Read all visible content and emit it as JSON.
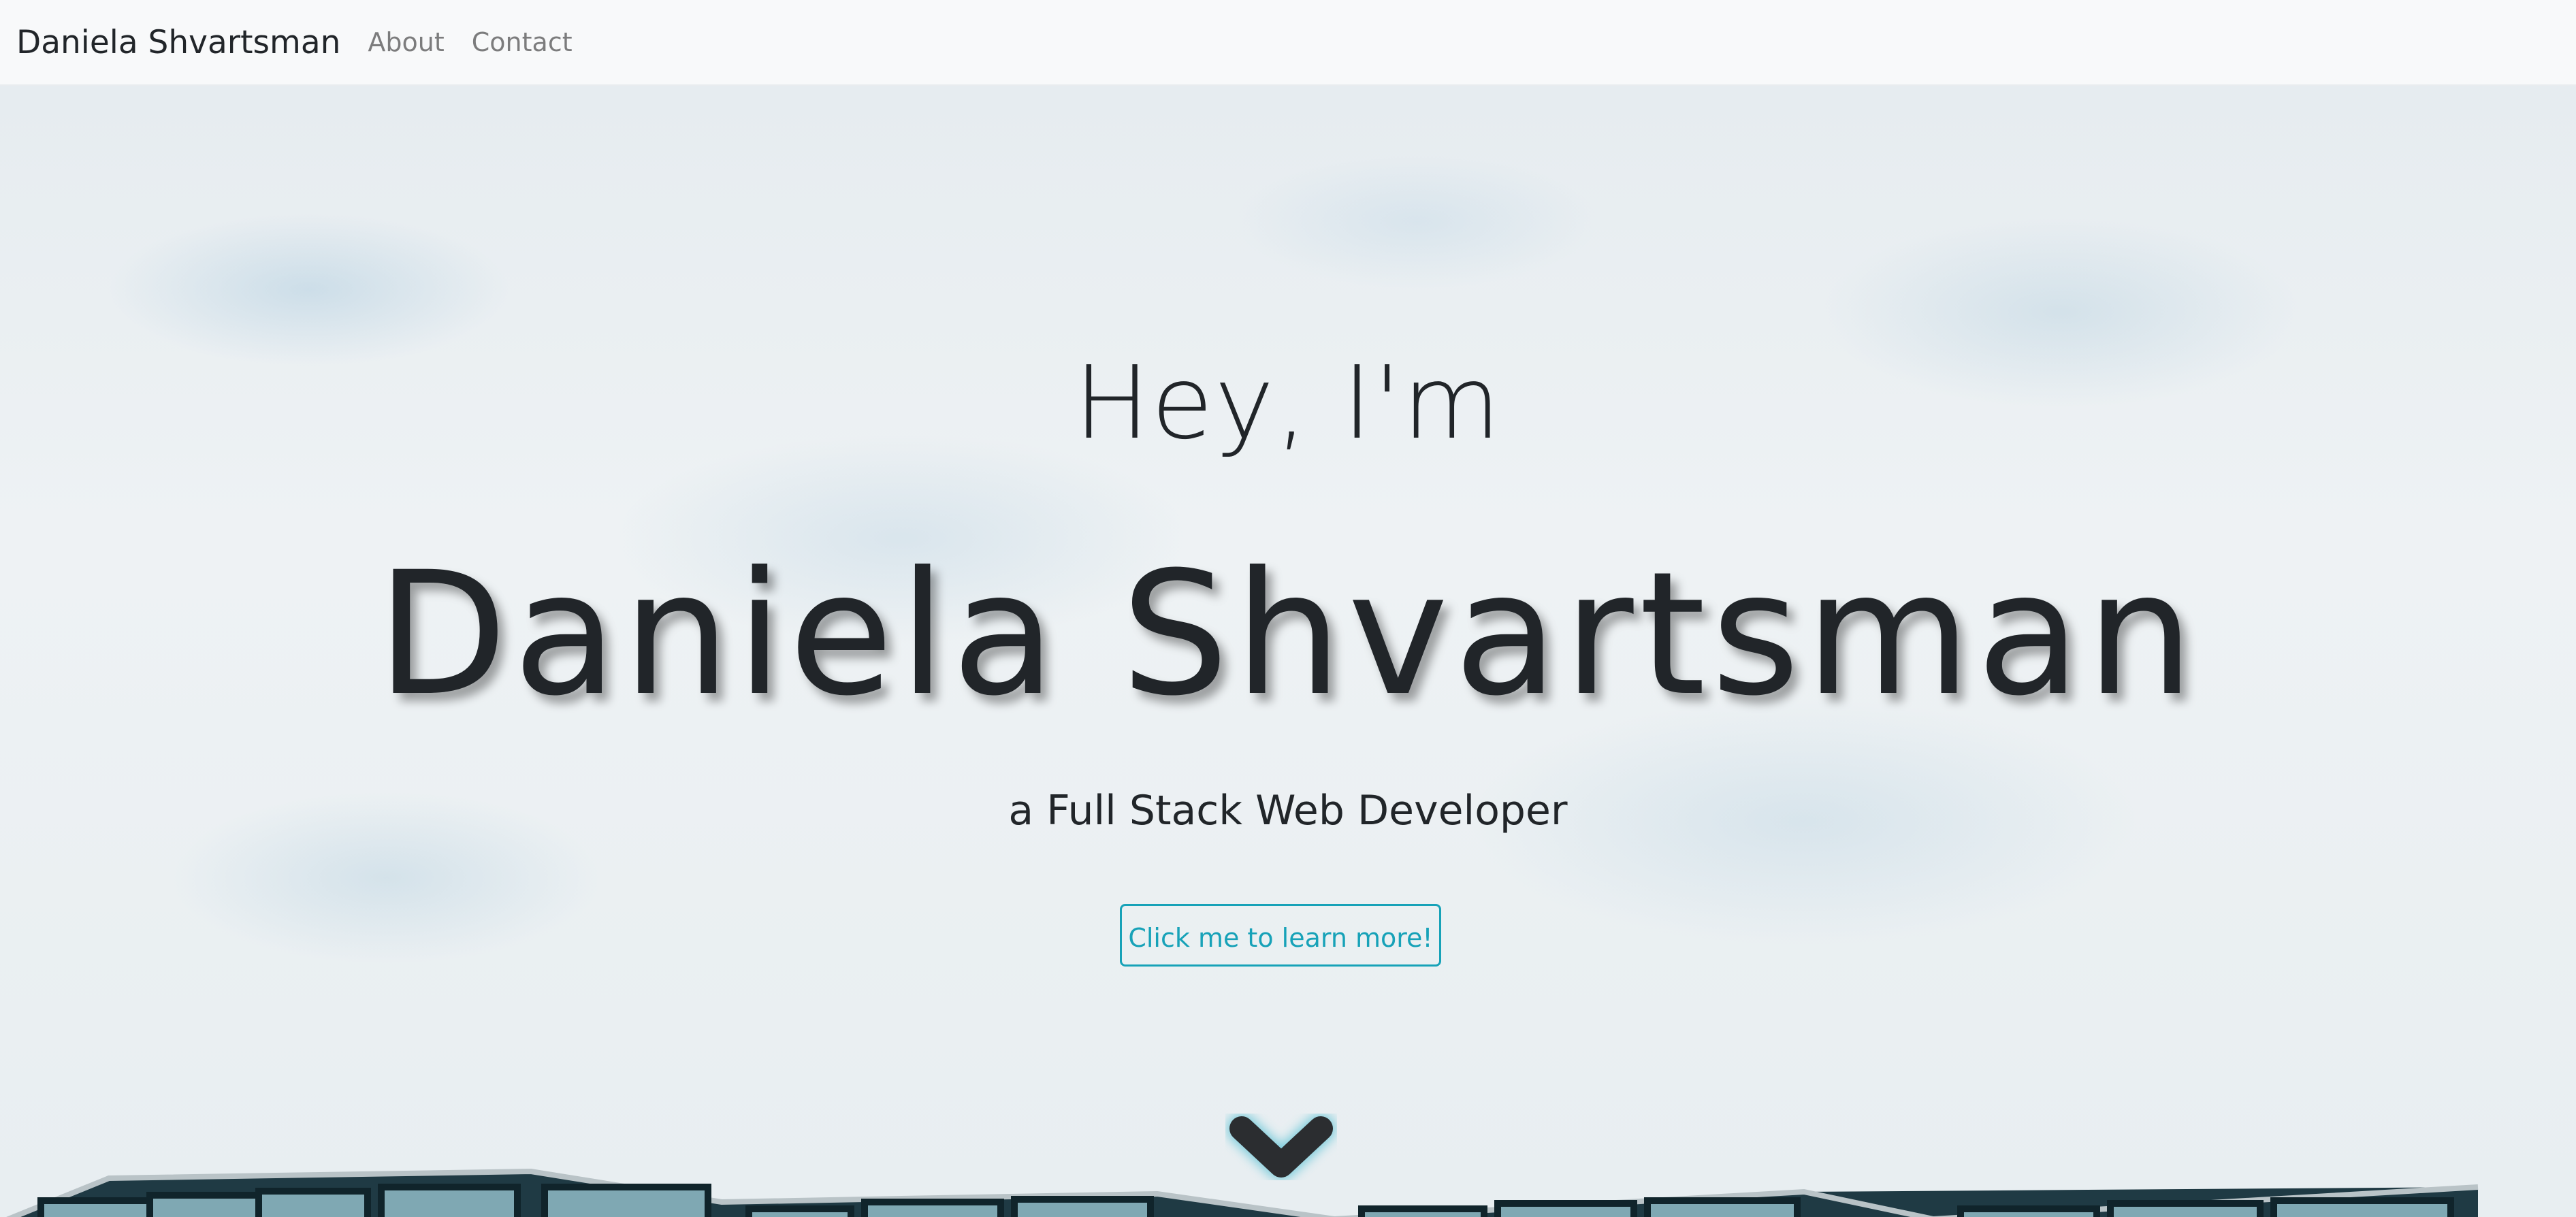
{
  "navbar": {
    "brand": "Daniela Shvartsman",
    "links": [
      {
        "label": "About"
      },
      {
        "label": "Contact"
      }
    ]
  },
  "hero": {
    "greeting": "Hey, I'm",
    "name": "Daniela Shvartsman",
    "subtitle": "a Full Stack Web Developer",
    "cta_label": "Click me to learn more!"
  },
  "icons": {
    "scroll_down": "chevron-down-icon"
  },
  "colors": {
    "navbar_bg": "#f8f9fa",
    "text_dark": "#212529",
    "accent": "#17a2b8",
    "nav_link": "rgba(0,0,0,0.5)"
  }
}
